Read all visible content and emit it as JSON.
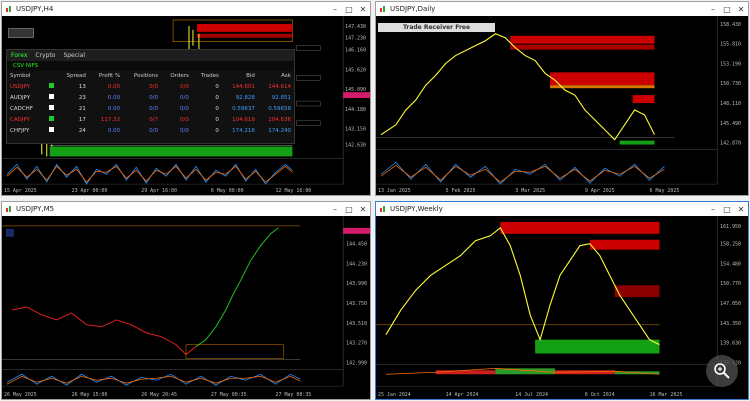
{
  "windows": {
    "h4": {
      "title": "USDJPY,H4"
    },
    "daily": {
      "title": "USDJPY,Daily"
    },
    "m5": {
      "title": "USDJPY,M5"
    },
    "weekly": {
      "title": "USDJPY,Weekly"
    }
  },
  "banner": {
    "text": "Trade Receiver Free"
  },
  "market_watch": {
    "tabs": [
      "Forex",
      "Crypto",
      "Special"
    ],
    "sub": "CSV NIFS",
    "headers": [
      "Symbol",
      "Spread",
      "Profit %",
      "Positions",
      "Orders",
      "Trades",
      "Bid",
      "Ask"
    ],
    "rows": [
      {
        "symbol": "USDJPY",
        "spread": "13",
        "profit": "0.00",
        "positions": "0/0",
        "orders": "0/0",
        "trades": "0",
        "bid": "144.601",
        "ask": "144.614",
        "active": true
      },
      {
        "symbol": "AUDJPY",
        "spread": "23",
        "profit": "0.00",
        "positions": "0/0",
        "orders": "0/0",
        "trades": "0",
        "bid": "92.828",
        "ask": "92.851",
        "active": false
      },
      {
        "symbol": "CADCHF",
        "spread": "21",
        "profit": "0.00",
        "positions": "0/0",
        "orders": "0/0",
        "trades": "0",
        "bid": "0.59637",
        "ask": "0.59658",
        "active": false
      },
      {
        "symbol": "CADJPY",
        "spread": "17",
        "profit": "117.32",
        "positions": "0/7",
        "orders": "0/0",
        "trades": "0",
        "bid": "104.619",
        "ask": "104.636",
        "active": true
      },
      {
        "symbol": "CHFJPY",
        "spread": "24",
        "profit": "0.00",
        "positions": "0/0",
        "orders": "0/0",
        "trades": "0",
        "bid": "174.216",
        "ask": "174.240",
        "active": false
      }
    ]
  },
  "colors": {
    "bull": "#ffff33",
    "bear": "#ffff33",
    "supply": "#cc0000",
    "demand": "#14a014",
    "accent": "#3a7bd5"
  }
}
